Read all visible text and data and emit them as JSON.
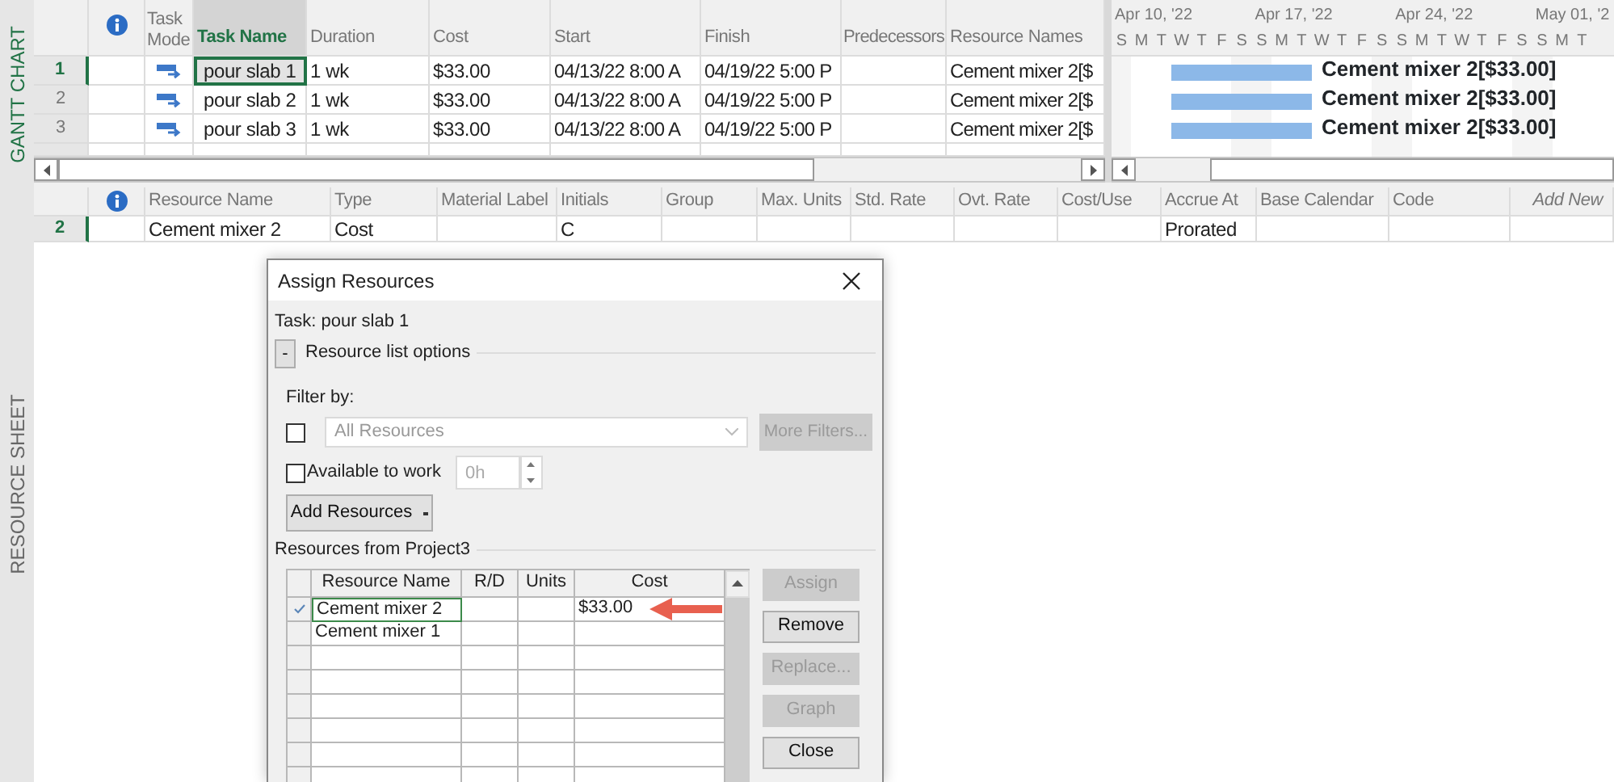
{
  "side_tabs": [
    {
      "label": "GANTT CHART",
      "selected": true
    },
    {
      "label": "RESOURCE SHEET",
      "selected": false
    }
  ],
  "gantt_table": {
    "columns": [
      {
        "label": "Task Mode",
        "selected": false
      },
      {
        "label": "Task Name",
        "selected": true
      },
      {
        "label": "Duration",
        "selected": false
      },
      {
        "label": "Cost",
        "selected": false
      },
      {
        "label": "Start",
        "selected": false
      },
      {
        "label": "Finish",
        "selected": false
      },
      {
        "label": "Predecessors",
        "selected": false
      },
      {
        "label": "Resource Names",
        "selected": false
      }
    ],
    "tasks": [
      {
        "id": "1",
        "name": "pour slab 1",
        "duration": "1 wk",
        "cost": "$33.00",
        "start": "04/13/22 8:00 A",
        "finish": "04/19/22 5:00 P",
        "resource_names": "Cement mixer 2[$",
        "bar_label": "Cement mixer 2[$33.00]",
        "selected": true
      },
      {
        "id": "2",
        "name": "pour slab 2",
        "duration": "1 wk",
        "cost": "$33.00",
        "start": "04/13/22 8:00 A",
        "finish": "04/19/22 5:00 P",
        "resource_names": "Cement mixer 2[$",
        "bar_label": "Cement mixer 2[$33.00]",
        "selected": false
      },
      {
        "id": "3",
        "name": "pour slab 3",
        "duration": "1 wk",
        "cost": "$33.00",
        "start": "04/13/22 8:00 A",
        "finish": "04/19/22 5:00 P",
        "resource_names": "Cement mixer 2[$",
        "bar_label": "Cement mixer 2[$33.00]",
        "selected": false
      }
    ]
  },
  "timescale": {
    "weeks": [
      "Apr 10, '22",
      "Apr 17, '22",
      "Apr 24, '22",
      "May 01, '2"
    ],
    "days": [
      "S",
      "M",
      "T",
      "W",
      "T",
      "F",
      "S",
      "S",
      "M",
      "T",
      "W",
      "T",
      "F",
      "S",
      "S",
      "M",
      "T",
      "W",
      "T",
      "F",
      "S",
      "S",
      "M",
      "T"
    ]
  },
  "resource_sheet": {
    "columns": [
      {
        "label": "Resource Name",
        "kind": "normal"
      },
      {
        "label": "Type",
        "kind": "normal"
      },
      {
        "label": "Material Label",
        "kind": "normal"
      },
      {
        "label": "Initials",
        "kind": "normal"
      },
      {
        "label": "Group",
        "kind": "normal"
      },
      {
        "label": "Max. Units",
        "kind": "normal"
      },
      {
        "label": "Std. Rate",
        "kind": "normal"
      },
      {
        "label": "Ovt. Rate",
        "kind": "normal"
      },
      {
        "label": "Cost/Use",
        "kind": "normal"
      },
      {
        "label": "Accrue At",
        "kind": "normal"
      },
      {
        "label": "Base Calendar",
        "kind": "normal"
      },
      {
        "label": "Code",
        "kind": "normal"
      },
      {
        "label": "Add New",
        "kind": "add"
      }
    ],
    "rows": [
      {
        "id": "2",
        "name": "Cement mixer 2",
        "type": "Cost",
        "initials": "C",
        "accrue_at": "Prorated",
        "selected": true
      }
    ]
  },
  "dialog": {
    "title": "Assign Resources",
    "task_label": "Task: pour slab 1",
    "options_toggle": "-",
    "options_label": "Resource list options",
    "filter_label": "Filter by:",
    "filter": {
      "checked": false,
      "value": "All Resources",
      "disabled": true
    },
    "more_filters": {
      "label": "More Filters...",
      "disabled": true
    },
    "available": {
      "label": "Available to work",
      "checked": false
    },
    "hours": {
      "value": "0h",
      "disabled": true
    },
    "add_resources": "Add Resources",
    "resources_label": "Resources from Project3",
    "grid_columns": [
      "Resource Name",
      "R/D",
      "Units",
      "Cost"
    ],
    "resources": [
      {
        "name": "Cement mixer 2",
        "cost": "$33.00",
        "assigned": true,
        "selected": true
      },
      {
        "name": "Cement mixer 1",
        "assigned": false,
        "selected": false
      }
    ],
    "buttons": [
      {
        "label": "Assign",
        "disabled": true
      },
      {
        "label": "Remove",
        "disabled": false
      },
      {
        "label": "Replace...",
        "disabled": true
      },
      {
        "label": "Graph",
        "disabled": true
      },
      {
        "label": "Close",
        "disabled": false
      }
    ]
  }
}
